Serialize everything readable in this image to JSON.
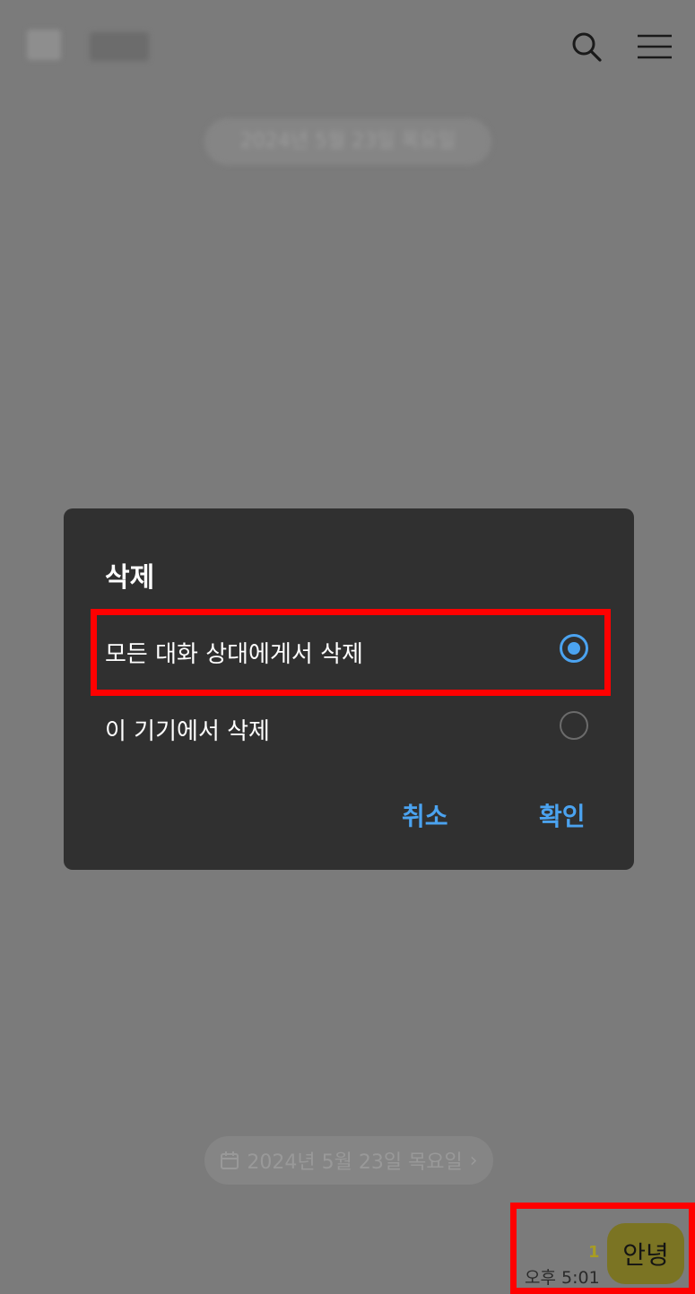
{
  "header": {
    "search_icon": "search-icon",
    "menu_icon": "hamburger-menu-icon"
  },
  "chat": {
    "date_divider": "2024년 5월 23일 목요일",
    "message": {
      "text": "안녕",
      "unread_count": "1",
      "time": "오후 5:01"
    }
  },
  "dialog": {
    "title": "삭제",
    "options": [
      {
        "label": "모든 대화 상대에게서 삭제",
        "selected": true
      },
      {
        "label": "이 기기에서 삭제",
        "selected": false
      }
    ],
    "cancel_label": "취소",
    "confirm_label": "확인"
  },
  "colors": {
    "accent": "#4ba3f0",
    "highlight": "#ff0000",
    "dialog_bg": "#303030",
    "overlay_bg": "#7b7b7b"
  }
}
